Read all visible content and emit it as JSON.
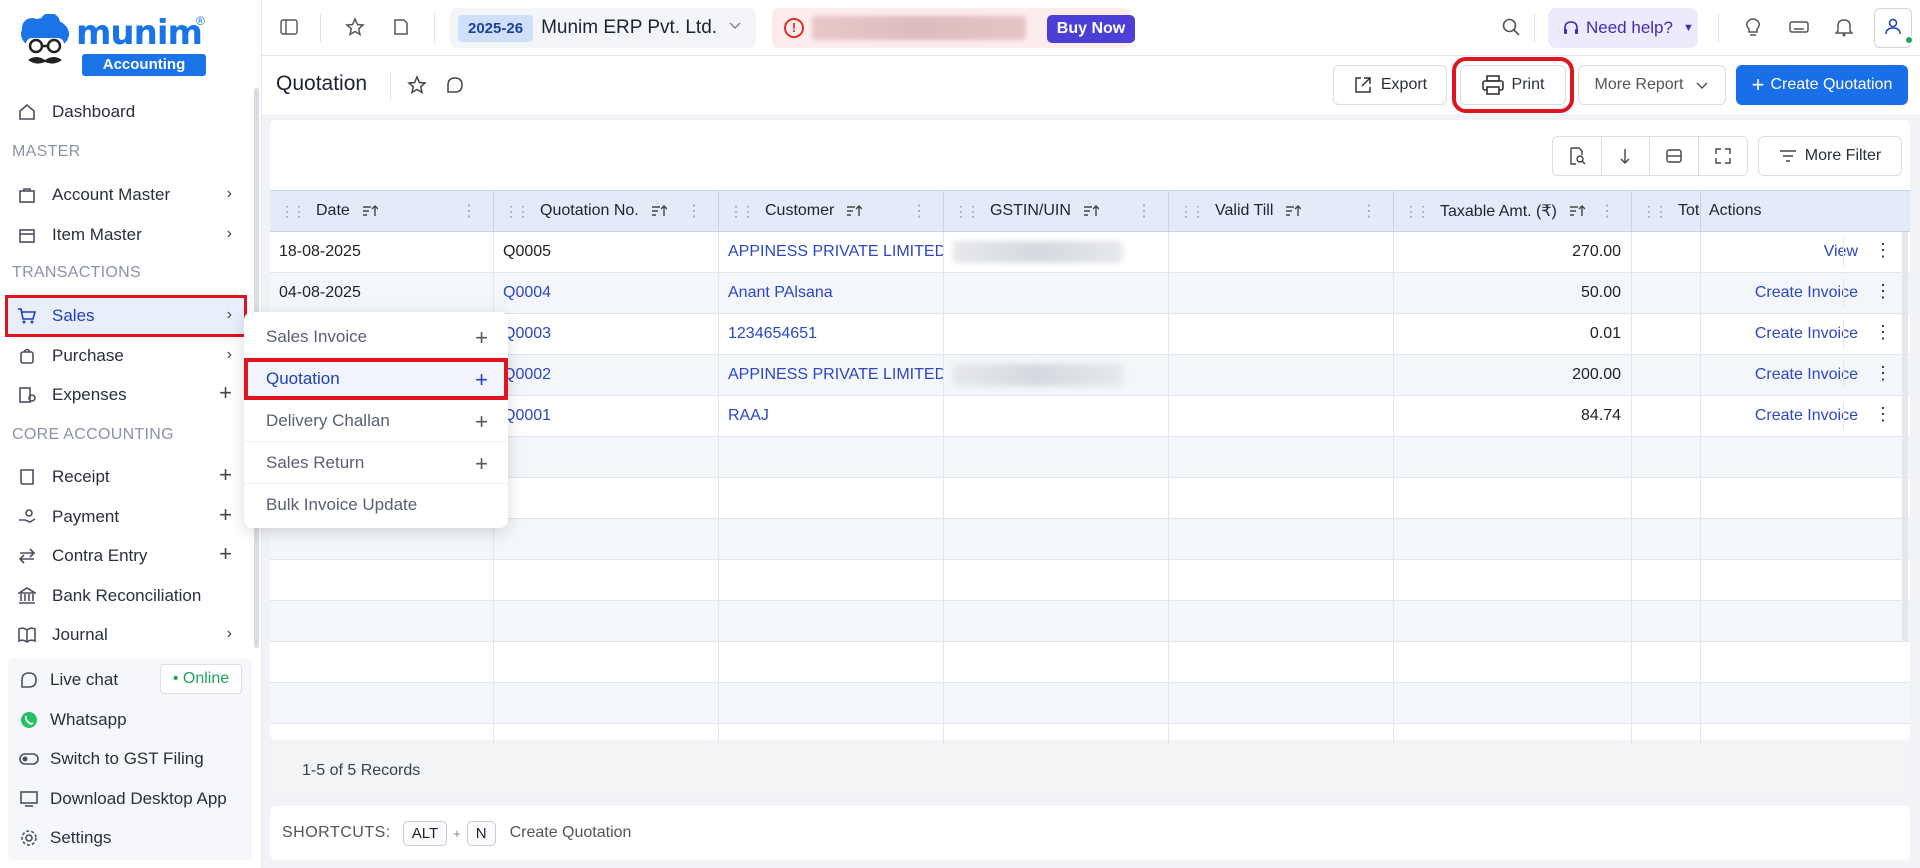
{
  "logo": {
    "brand": "munim",
    "reg": "®",
    "sub": "Accounting"
  },
  "sidebar": {
    "items": [
      {
        "label": "Dashboard"
      },
      {
        "label": "Account Master"
      },
      {
        "label": "Item Master"
      },
      {
        "label": "Sales"
      },
      {
        "label": "Purchase"
      },
      {
        "label": "Expenses"
      },
      {
        "label": "Receipt"
      },
      {
        "label": "Payment"
      },
      {
        "label": "Contra Entry"
      },
      {
        "label": "Bank Reconciliation"
      },
      {
        "label": "Journal"
      }
    ],
    "sections": {
      "master": "MASTER",
      "transactions": "TRANSACTIONS",
      "core": "CORE ACCOUNTING"
    },
    "bottom": {
      "live_chat": "Live chat",
      "online": "• Online",
      "whatsapp": "Whatsapp",
      "gst": "Switch to GST Filing",
      "desktop": "Download Desktop App",
      "settings": "Settings"
    }
  },
  "flyout": {
    "items": [
      {
        "label": "Sales Invoice"
      },
      {
        "label": "Quotation"
      },
      {
        "label": "Delivery Challan"
      },
      {
        "label": "Sales Return"
      },
      {
        "label": "Bulk Invoice Update"
      }
    ]
  },
  "topbar": {
    "fy": "2025-26",
    "company": "Munim ERP Pvt. Ltd.",
    "buy_now": "Buy Now",
    "help": "Need help?"
  },
  "page": {
    "title": "Quotation",
    "export": "Export",
    "print": "Print",
    "more_report": "More Report",
    "create": "Create Quotation",
    "more_filter": "More Filter"
  },
  "table": {
    "columns": [
      "Date",
      "Quotation No.",
      "Customer",
      "GSTIN/UIN",
      "Valid Till",
      "Taxable Amt. (₹)",
      "Total",
      "Actions"
    ],
    "rows": [
      {
        "date": "18-08-2025",
        "no": "Q0005",
        "customer": "APPINESS PRIVATE LIMITED",
        "taxable": "270.00",
        "action": "View"
      },
      {
        "date": "04-08-2025",
        "no": "Q0004",
        "customer": "Anant PAlsana",
        "taxable": "50.00",
        "action": "Create Invoice"
      },
      {
        "date": "",
        "no": "Q0003",
        "customer": "1234654651",
        "taxable": "0.01",
        "action": "Create Invoice"
      },
      {
        "date": "",
        "no": "Q0002",
        "customer": "APPINESS PRIVATE LIMITED",
        "taxable": "200.00",
        "action": "Create Invoice"
      },
      {
        "date": "",
        "no": "Q0001",
        "customer": "RAAJ",
        "taxable": "84.74",
        "action": "Create Invoice"
      }
    ],
    "records": "1-5 of 5 Records"
  },
  "shortcuts": {
    "label": "SHORTCUTS:",
    "key1": "ALT",
    "plus": "+",
    "key2": "N",
    "desc": "Create Quotation"
  }
}
